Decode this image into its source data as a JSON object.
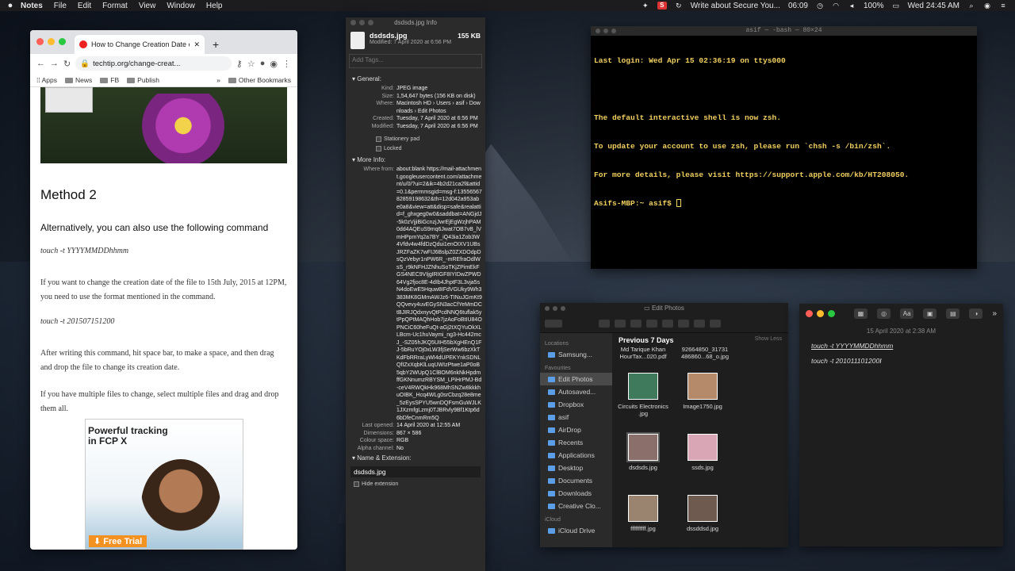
{
  "menubar": {
    "app": "Notes",
    "items": [
      "File",
      "Edit",
      "Format",
      "View",
      "Window",
      "Help"
    ],
    "status_note": "Write about Secure You...",
    "clock_short": "06:09",
    "battery": "100%",
    "datetime": "Wed 24:45 AM"
  },
  "browser": {
    "tab_title": "How to Change Creation Date of",
    "url": "techtip.org/change-creat...",
    "bookmarks": [
      "Apps",
      "News",
      "FB",
      "Publish"
    ],
    "other_bookmarks": "Other Bookmarks",
    "heading": "Method 2",
    "lead": "Alternatively, you can also use the following command",
    "cmd1": "touch -t YYYYMMDDhhmm",
    "para1": "If you want to change the creation date of the file to 15th July, 2015 at 12PM, you need to use the format mentioned in the command.",
    "cmd2": "touch -t 201507151200",
    "para2": "After writing this command, hit space bar, to make a space, and then drag and drop the file to change its creation date.",
    "para3": "If you have multiple files to change, select multiple files and drag and drop them all.",
    "ad_title": "Powerful tracking in FCP X",
    "ad_cta": "Free Trial"
  },
  "info": {
    "window_title": "dsdsds.jpg Info",
    "file_name": "dsdsds.jpg",
    "file_size": "155 KB",
    "modified_line": "Modified: 7 April 2020 at 6:56 PM",
    "tags_placeholder": "Add Tags...",
    "general_label": "General:",
    "general_rows": [
      {
        "k": "Kind:",
        "v": "JPEG image"
      },
      {
        "k": "Size:",
        "v": "1,54,647 bytes (156 KB on disk)"
      },
      {
        "k": "Where:",
        "v": "Macintosh HD › Users › asif › Downloads › Edit Photos"
      },
      {
        "k": "Created:",
        "v": "Tuesday, 7 April 2020 at 6:56 PM"
      },
      {
        "k": "Modified:",
        "v": "Tuesday, 7 April 2020 at 6:56 PM"
      }
    ],
    "stationery": "Stationery pad",
    "locked": "Locked",
    "more_info_label": "More Info:",
    "where_from_key": "Where from:",
    "where_from": "about:blank https://mail-attachment.googleusercontent.com/attachment/u/0/?ui=2&ik=4b2d21ca2f&attid=0.1&permmsgid=msg-f:1355656782859198632&th=12d042a953abe0a8&view=att&disp=safe&realattid=f_ghxgeg0w0&saddbat=ANGjdJ-5k0zVjjiBiGcnzjJwrEjEgWzjhPAM0dd4AQEuS9mq6Jwat7OB7vB_lVmHPpmYq2a7BY_iQ43ia1Zob3W4Vfdv4w4fdDzQdui1enOIXV1UBsJRZFaZK7wFIJ6BslpZ0ZXDOdpDsQzVebyr1nPW6R_-mREfraOdlWsS_r9kNFHJZNhuSoTKjZPimEkFGS4NEC9VIjgIRIGF8IYIDwZPWD64Vg2fjoc8E-4dIb4JhptF3L3vja5sN4doEwE5Hquw8IFdVGUky9Wh3383MK8GMmAWJz6-TINuJGmKt9QQvevy4uvEGySN3acCfYeMmDCtBJIRJQdxnyvQtPcdNNQ6tuflak5ytPpQPtMAQhHob7jzAoFoBtIU84OPNCiC60heFuQt-aGj2tXQYuOkXLLBcm-Uc1huVaymi_ng3-Hc442mcJ_-SZ05hJKQ5UIH55bXgHEnQ1FJ-5bRuYOj0xLW3fjSerWw6bzXkTKdFbRRraLyWI4dUPEKYnkSDNLQfIZxXqbKlLuqUWIzPtwe1aP0oB5qbY2WUpQ1ClBOM6nkNkHpdmffGKNnumzRBYSM_LPiHrPMJ-Bd-ceV4RWQkHk968MhSNZw8kkkhuOIBK_Hcq4WLg0srCbzq28e8me_5zEysSPYU5wnDQFsmGuWJLK1JXzmfgLzmj0TJBRvly9Bf1Ktp6d6bDfeCnmRm5Q",
    "opened_rows": [
      {
        "k": "Last opened:",
        "v": "14 April 2020 at 12:55 AM"
      },
      {
        "k": "Dimensions:",
        "v": "867 × 586"
      },
      {
        "k": "Colour space:",
        "v": "RGB"
      },
      {
        "k": "Alpha channel:",
        "v": "No"
      }
    ],
    "name_ext_label": "Name & Extension:",
    "name_field": "dsdsds.jpg",
    "hide_ext": "Hide extension"
  },
  "terminal": {
    "title": "asif — -bash — 80×24",
    "lines": [
      "Last login: Wed Apr 15 02:36:19 on ttys000",
      "",
      "The default interactive shell is now zsh.",
      "To update your account to use zsh, please run `chsh -s /bin/zsh`.",
      "For more details, please visit https://support.apple.com/kb/HT208050."
    ],
    "prompt": "Asifs-MBP:~ asif$ "
  },
  "finder": {
    "title": "Edit Photos",
    "locations_label": "Locations",
    "samsung": "Samsung...",
    "favourites_label": "Favourites",
    "favourites": [
      "Edit Photos",
      "Autosaved...",
      "Dropbox",
      "asif",
      "AirDrop",
      "Recents",
      "Applications",
      "Desktop",
      "Documents",
      "Downloads",
      "Creative Clo..."
    ],
    "icloud_label": "iCloud",
    "icloud_drive": "iCloud Drive",
    "section": "Previous 7 Days",
    "show_less": "Show Less",
    "top_files": [
      "Md Tarique Khan HourTax...020.pdf",
      "92664850_31731 486860...68_o.jpg"
    ],
    "files": [
      "Circuits Electronics .jpg",
      "Image1750.jpg",
      "dsdsds.jpg",
      "ssds.jpg",
      "ffffffffff.jpg",
      "dssddsd.jpg"
    ],
    "file_colors": [
      "#3f7a5c",
      "#b58a6a",
      "#8a6f6a",
      "#d9a6b5",
      "#9a8470",
      "#6f5a50"
    ]
  },
  "notes": {
    "date": "15 April 2020 at 2:38 AM",
    "line1": "touch -t YYYYMMDDhhmm",
    "line2": "touch -t 201011101200"
  }
}
